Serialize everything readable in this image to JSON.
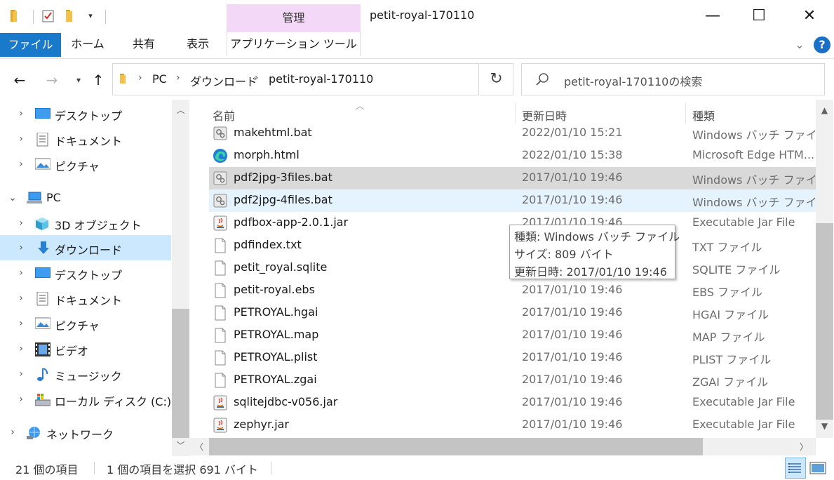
{
  "window": {
    "title": "petit-royal-170110",
    "tools_title": "管理",
    "minimize_glyph": "—",
    "maximize_glyph": "☐",
    "close_glyph": "✕"
  },
  "ribbon": {
    "tabs": [
      "ファイル",
      "ホーム",
      "共有",
      "表示",
      "アプリケーション ツール"
    ],
    "expand_glyph": "⌄",
    "help_glyph": "?"
  },
  "address": {
    "crumbs": [
      "PC",
      "ダウンロード",
      "petit-royal-170110"
    ],
    "search_placeholder": "petit-royal-170110の検索"
  },
  "nav": {
    "items": [
      {
        "label": "デスクトップ",
        "icon": "desktop-icon"
      },
      {
        "label": "ドキュメント",
        "icon": "documents-icon"
      },
      {
        "label": "ピクチャ",
        "icon": "pictures-icon"
      },
      {
        "label": "PC",
        "icon": "pc-icon"
      },
      {
        "label": "3D オブジェクト",
        "icon": "3d-objects-icon"
      },
      {
        "label": "ダウンロード",
        "icon": "downloads-icon"
      },
      {
        "label": "デスクトップ",
        "icon": "desktop-icon"
      },
      {
        "label": "ドキュメント",
        "icon": "documents-icon"
      },
      {
        "label": "ピクチャ",
        "icon": "pictures-icon"
      },
      {
        "label": "ビデオ",
        "icon": "videos-icon"
      },
      {
        "label": "ミュージック",
        "icon": "music-icon"
      },
      {
        "label": "ローカル ディスク (C:)",
        "icon": "local-disk-icon"
      },
      {
        "label": "ネットワーク",
        "icon": "network-icon"
      }
    ]
  },
  "columns": {
    "name": "名前",
    "date": "更新日時",
    "type": "種類"
  },
  "files": [
    {
      "name": "makehtml.bat",
      "date": "2022/01/10 15:21",
      "type": "Windows バッチ ファイル",
      "icon": "bat"
    },
    {
      "name": "morph.html",
      "date": "2022/01/10 15:38",
      "type": "Microsoft Edge HTM...",
      "icon": "edge"
    },
    {
      "name": "pdf2jpg-3files.bat",
      "date": "2017/01/10 19:46",
      "type": "Windows バッチ ファイル",
      "icon": "bat"
    },
    {
      "name": "pdf2jpg-4files.bat",
      "date": "2017/01/10 19:46",
      "type": "Windows バッチ ファイル",
      "icon": "bat"
    },
    {
      "name": "pdfbox-app-2.0.1.jar",
      "date": "2017/01/10 19:46",
      "type": "Executable Jar File",
      "icon": "jar"
    },
    {
      "name": "pdfindex.txt",
      "date": "",
      "type": "TXT ファイル",
      "icon": "doc"
    },
    {
      "name": "petit_royal.sqlite",
      "date": "",
      "type": "SQLITE ファイル",
      "icon": "doc"
    },
    {
      "name": "petit-royal.ebs",
      "date": "2017/01/10 19:46",
      "type": "EBS ファイル",
      "icon": "doc"
    },
    {
      "name": "PETROYAL.hgai",
      "date": "2017/01/10 19:46",
      "type": "HGAI ファイル",
      "icon": "doc"
    },
    {
      "name": "PETROYAL.map",
      "date": "2017/01/10 19:46",
      "type": "MAP ファイル",
      "icon": "doc"
    },
    {
      "name": "PETROYAL.plist",
      "date": "2017/01/10 19:46",
      "type": "PLIST ファイル",
      "icon": "doc"
    },
    {
      "name": "PETROYAL.zgai",
      "date": "2017/01/10 19:46",
      "type": "ZGAI ファイル",
      "icon": "doc"
    },
    {
      "name": "sqlitejdbc-v056.jar",
      "date": "2017/01/10 19:46",
      "type": "Executable Jar File",
      "icon": "jar"
    },
    {
      "name": "zephyr.jar",
      "date": "2017/01/10 19:46",
      "type": "Executable Jar File",
      "icon": "jar"
    }
  ],
  "tooltip": {
    "type_line": "種類: Windows バッチ ファイル",
    "size_line": "サイズ: 809 バイト",
    "date_line": "更新日時: 2017/01/10 19:46"
  },
  "status": {
    "item_count": "21 個の項目",
    "selection": "1 個の項目を選択  691 バイト"
  },
  "colors": {
    "file_tab": "#1979ca",
    "tools_tab": "#f4d8f7",
    "nav_selected": "#cce8ff",
    "row_selected": "#d9d9d9",
    "row_hover": "#e5f3ff"
  }
}
